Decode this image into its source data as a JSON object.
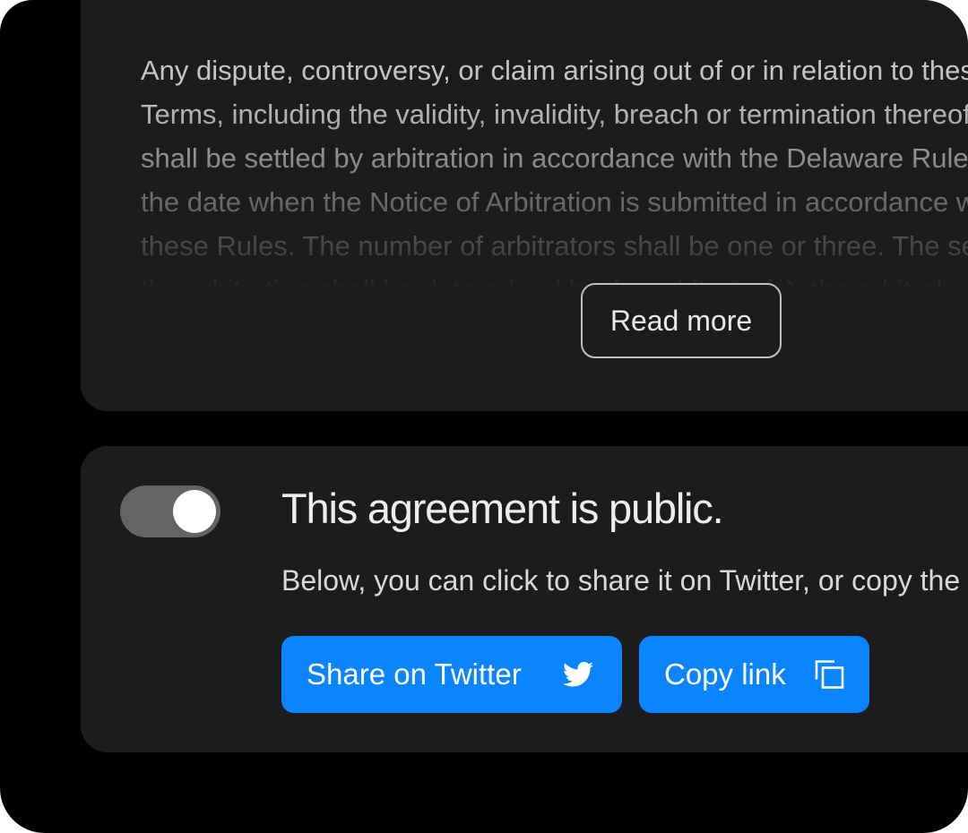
{
  "terms": {
    "text": "Any dispute, controversy, or claim arising out of or in relation to these\nTerms, including the validity, invalidity, breach or termination thereof,\nshall be settled by arbitration in accordance with the Delaware Rules in force on\nthe date when the Notice of Arbitration is submitted in accordance with\nthese Rules. The number of arbitrators shall be one or three. The seat of\nthe arbitration shall be determined by the arbitrator(s); the arbitral",
    "read_more_label": "Read more"
  },
  "public": {
    "toggle_on": true,
    "title": "This agreement is public.",
    "description": "Below, you can click to share it on Twitter, or copy the link.",
    "share_label": "Share on Twitter",
    "share_icon": "twitter-bird-icon",
    "copy_label": "Copy link",
    "copy_icon": "copy-icon"
  },
  "colors": {
    "background": "#000000",
    "card": "#1c1c1e",
    "accent": "#0a84ff",
    "toggle_track": "#646466"
  }
}
